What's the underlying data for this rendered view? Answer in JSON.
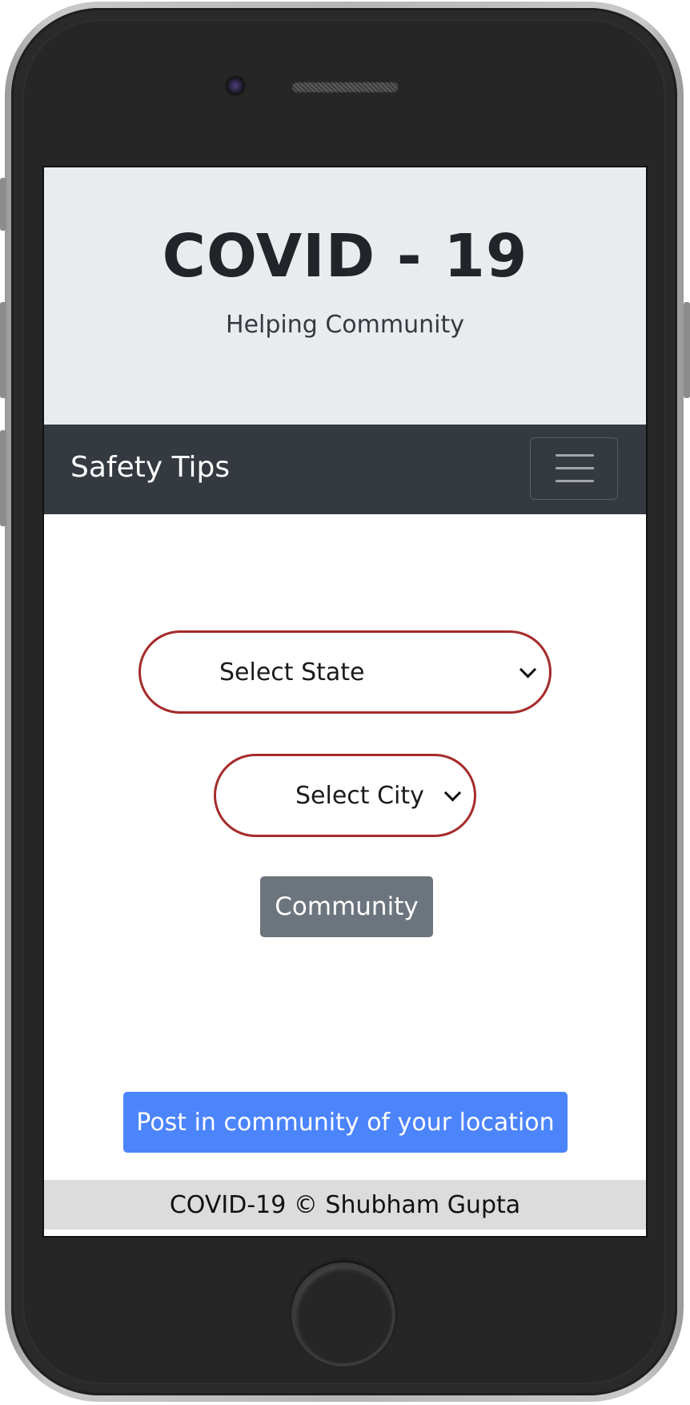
{
  "header": {
    "title": "COVID - 19",
    "subtitle": "Helping Community"
  },
  "navbar": {
    "brand": "Safety Tips",
    "menu_icon": "hamburger-menu-icon"
  },
  "form": {
    "state_select": {
      "value": "Select State",
      "icon": "chevron-down-icon"
    },
    "city_select": {
      "value": "Select City",
      "icon": "chevron-down-icon"
    },
    "community_button": "Community"
  },
  "post_button": "Post in community of your location",
  "footer": {
    "text": "COVID-19 © Shubham Gupta"
  },
  "colors": {
    "jumbotron_bg": "#e9ecef",
    "navbar_bg": "#343a40",
    "select_border": "#a52a2a",
    "community_button_bg": "#6c757d",
    "post_button_bg": "#4c84fb",
    "footer_bg": "#dcdcdc"
  }
}
